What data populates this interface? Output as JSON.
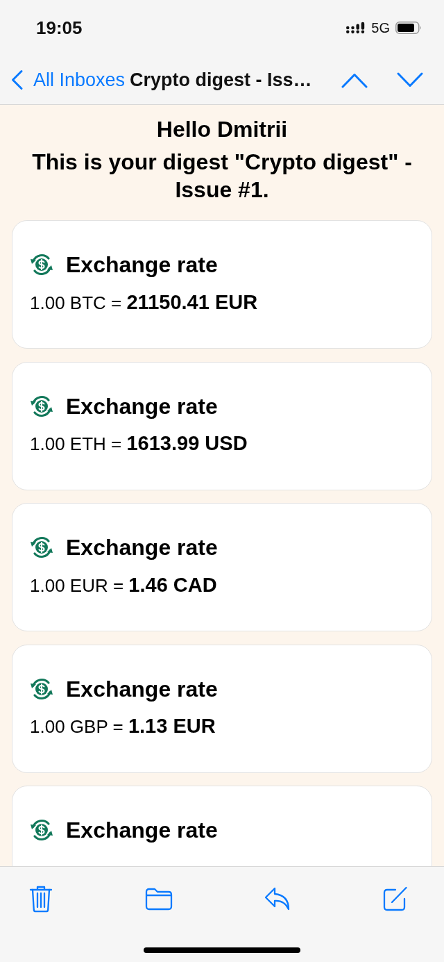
{
  "status_bar": {
    "time": "19:05",
    "network": "5G"
  },
  "nav_bar": {
    "back_label": "All Inboxes",
    "title": "Crypto digest - Iss…"
  },
  "email": {
    "greeting": "Hello Dmitrii",
    "intro": "This is your digest \"Crypto digest\" - Issue #1.",
    "cards": [
      {
        "title": "Exchange rate",
        "rate": "1.00 BTC = **21150.41 EUR**"
      },
      {
        "title": "Exchange rate",
        "rate": "1.00 ETH = **1613.99 USD**"
      },
      {
        "title": "Exchange rate",
        "rate": "1.00 EUR = **1.46 CAD**"
      },
      {
        "title": "Exchange rate",
        "rate": "1.00 GBP = **1.13 EUR**"
      },
      {
        "title": "Exchange rate"
      }
    ]
  }
}
